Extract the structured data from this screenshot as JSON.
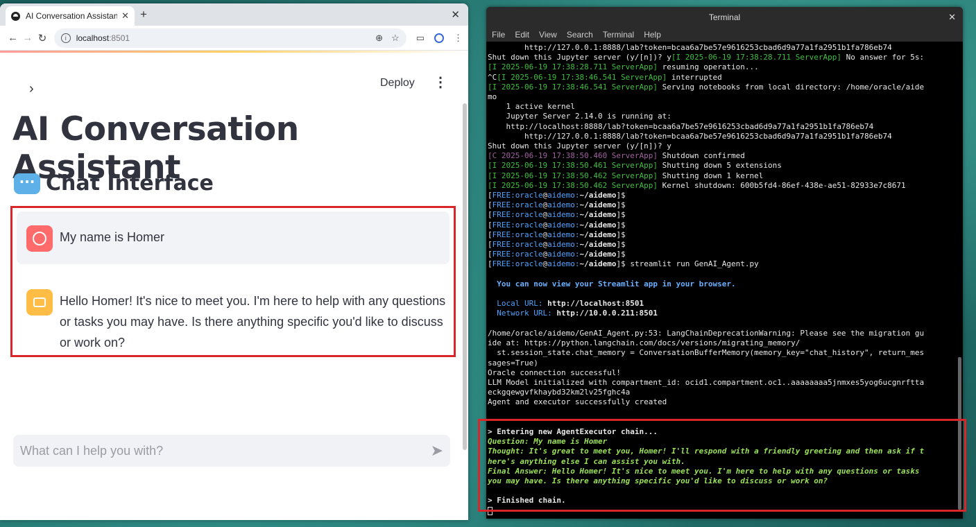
{
  "browser": {
    "tab_title": "AI Conversation Assistant",
    "url_host": "localhost",
    "url_port": ":8501",
    "deploy_label": "Deploy"
  },
  "app": {
    "title": "AI Conversation Assistant",
    "section_title": "Chat Interface",
    "user_message": "My name is Homer",
    "bot_message": "Hello Homer! It's nice to meet you. I'm here to help with any questions or tasks you may have. Is there anything specific you'd like to discuss or work on?",
    "input_placeholder": "What can I help you with?"
  },
  "terminal": {
    "title": "Terminal",
    "menu": [
      "File",
      "Edit",
      "View",
      "Search",
      "Terminal",
      "Help"
    ],
    "prompt_user": "FREE:oracle",
    "prompt_at": "@",
    "prompt_host": "aidemo:",
    "prompt_dir": "~/aidemo",
    "lines": {
      "l1": "        http://127.0.0.1:8888/lab?token=bcaa6a7be57e9616253cbad6d9a77a1fa2951b1fa786eb74",
      "l2a": "Shut down this Jupyter server (y/[n])? y",
      "l2b": "[I 2025-06-19 17:38:28.711 ServerApp]",
      "l2c": " No answer for 5s:",
      "l3a": "[I 2025-06-19 17:38:28.711 ServerApp]",
      "l3b": " resuming operation...",
      "l4a": "^C",
      "l4b": "[I 2025-06-19 17:38:46.541 ServerApp]",
      "l4c": " interrupted",
      "l5a": "[I 2025-06-19 17:38:46.541 ServerApp]",
      "l5b": " Serving notebooks from local directory: /home/oracle/aide",
      "l6": "mo",
      "l7": "    1 active kernel",
      "l8": "    Jupyter Server 2.14.0 is running at:",
      "l9": "    http://localhost:8888/lab?token=bcaa6a7be57e9616253cbad6d9a77a1fa2951b1fa786eb74",
      "l10": "        http://127.0.0.1:8888/lab?token=bcaa6a7be57e9616253cbad6d9a77a1fa2951b1fa786eb74",
      "l11": "Shut down this Jupyter server (y/[n])? y",
      "l12a": "[C 2025-06-19 17:38:50.460 ServerApp]",
      "l12b": " Shutdown confirmed",
      "l13a": "[I 2025-06-19 17:38:50.461 ServerApp]",
      "l13b": " Shutting down 5 extensions",
      "l14a": "[I 2025-06-19 17:38:50.462 ServerApp]",
      "l14b": " Shutting down 1 kernel",
      "l15a": "[I 2025-06-19 17:38:50.462 ServerApp]",
      "l15b": " Kernel shutdown: 600b5fd4-86ef-438e-ae51-82933e7c8671",
      "cmd": " streamlit run GenAI_Agent.py",
      "view": "  You can now view your Streamlit app in your browser.",
      "local_label": "  Local URL: ",
      "local_url": "http://localhost:8501",
      "net_label": "  Network URL: ",
      "net_url": "http://10.0.0.211:8501",
      "w1": "/home/oracle/aidemo/GenAI_Agent.py:53: LangChainDeprecationWarning: Please see the migration gu",
      "w2": "ide at: https://python.langchain.com/docs/versions/migrating_memory/",
      "w3": "  st.session_state.chat_memory = ConversationBufferMemory(memory_key=\"chat_history\", return_mes",
      "w4": "sages=True)",
      "o1": "Oracle connection successful!",
      "o2": "LLM Model initialized with compartment_id: ocid1.compartment.oc1..aaaaaaaa5jnmxes5yog6ucgnrftta",
      "o3": "eckgqewgvfkhaybd32km2lv25fghc4a",
      "o4": "Agent and executor successfully created",
      "c1": "> Entering new AgentExecutor chain...",
      "c2": "Question: My name is Homer",
      "c3": "Thought: It's great to meet you, Homer! I'll respond with a friendly greeting and then ask if t",
      "c4": "here's anything else I can assist you with.",
      "c5": "Final Answer: Hello Homer! It's nice to meet you. I'm here to help with any questions or tasks",
      "c6": "you may have. Is there anything specific you'd like to discuss or work on?",
      "c7": "> Finished chain."
    }
  },
  "colors": {
    "highlight": "#d9262b",
    "user_avatar": "#ff6b6b",
    "bot_avatar": "#ffbd45"
  }
}
